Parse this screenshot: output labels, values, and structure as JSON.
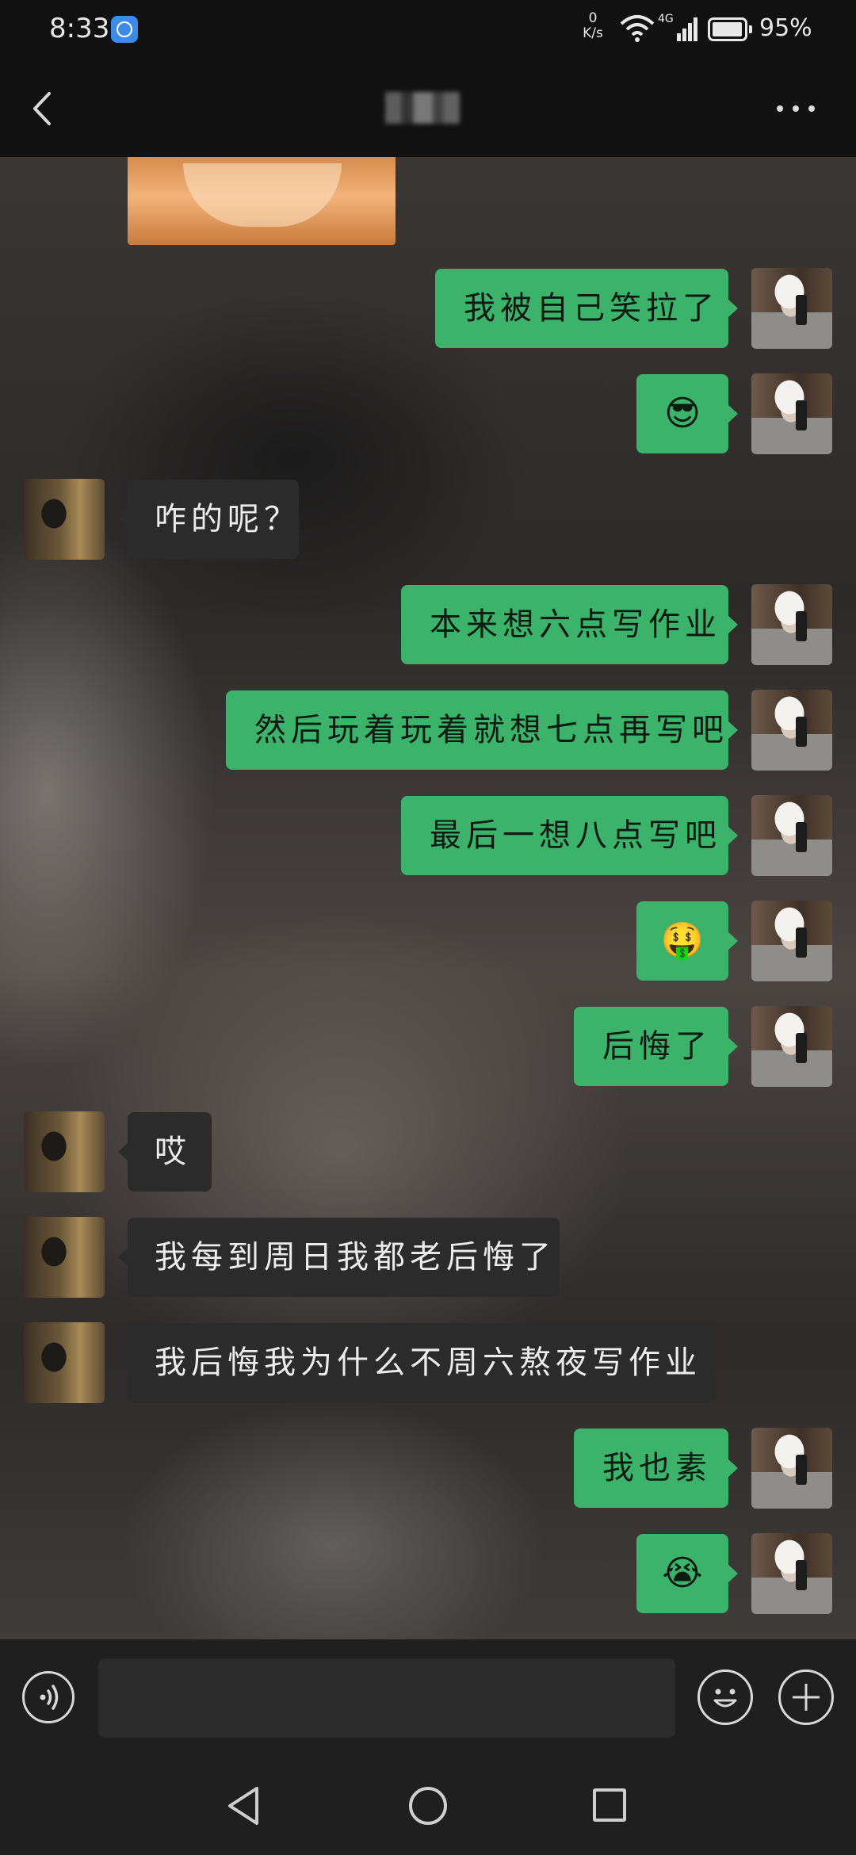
{
  "status_bar": {
    "time": "8:33",
    "net_speed_value": "0",
    "net_speed_unit": "K/s",
    "network_type": "4G",
    "battery": "95%"
  },
  "header": {
    "back_icon": "chevron-left-icon",
    "more_icon": "more-dots-icon"
  },
  "messages": [
    {
      "from": "self",
      "text": "我被自己笑拉了"
    },
    {
      "from": "self",
      "text": "😎"
    },
    {
      "from": "contact",
      "text": "咋的呢？"
    },
    {
      "from": "self",
      "text": "本来想六点写作业"
    },
    {
      "from": "self",
      "text": "然后玩着玩着就想七点再写吧"
    },
    {
      "from": "self",
      "text": "最后一想八点写吧"
    },
    {
      "from": "self",
      "text": "🤑"
    },
    {
      "from": "self",
      "text": "后悔了"
    },
    {
      "from": "contact",
      "text": "哎"
    },
    {
      "from": "contact",
      "text": "我每到周日我都老后悔了"
    },
    {
      "from": "contact",
      "text": "我后悔我为什么不周六熬夜写作业"
    },
    {
      "from": "self",
      "text": "我也素"
    },
    {
      "from": "self",
      "text": "😭"
    }
  ],
  "input_bar": {
    "voice_icon": "voice-icon",
    "input_value": "",
    "emoji_icon": "emoji-icon",
    "plus_icon": "plus-icon"
  },
  "nav_bar": {
    "back_icon": "nav-back-icon",
    "home_icon": "nav-home-icon",
    "recent_icon": "nav-recent-icon"
  },
  "colors": {
    "outgoing_bubble": "#3cb36b",
    "incoming_bubble": "#2b2b2b",
    "background": "#111111"
  }
}
